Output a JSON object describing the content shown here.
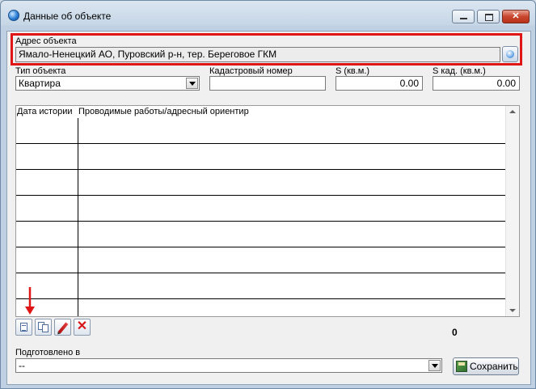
{
  "window": {
    "title": "Данные об объекте",
    "icon": "globe-icon"
  },
  "address": {
    "label": "Адрес объекта",
    "value": "Ямало-Ненецкий АО, Пуровский р-н, тер. Береговое ГКМ",
    "highlight_color": "#e01515"
  },
  "object_type": {
    "label": "Тип объекта",
    "value": "Квартира"
  },
  "cadastral_number": {
    "label": "Кадастровый номер",
    "value": ""
  },
  "area": {
    "label": "S (кв.м.)",
    "value": "0.00"
  },
  "cadastral_area": {
    "label": "S кад. (кв.м.)",
    "value": "0.00"
  },
  "history_grid": {
    "columns": [
      "Дата истории",
      "Проводимые работы/адресный ориентир"
    ],
    "rows": [
      [
        "",
        ""
      ],
      [
        "",
        ""
      ],
      [
        "",
        ""
      ],
      [
        "",
        ""
      ],
      [
        "",
        ""
      ],
      [
        "",
        ""
      ],
      [
        "",
        ""
      ],
      [
        "",
        ""
      ]
    ]
  },
  "grid_toolbar": {
    "buttons": [
      "add-record-icon",
      "copy-record-icon",
      "edit-pencil-icon",
      "delete-x-icon"
    ],
    "annotation_arrow_color": "#e01515"
  },
  "record_count": "0",
  "prepared_in": {
    "label": "Подготовлено в",
    "value": "--"
  },
  "save_button": {
    "label": "Сохранить",
    "icon": "save-disk-icon"
  }
}
